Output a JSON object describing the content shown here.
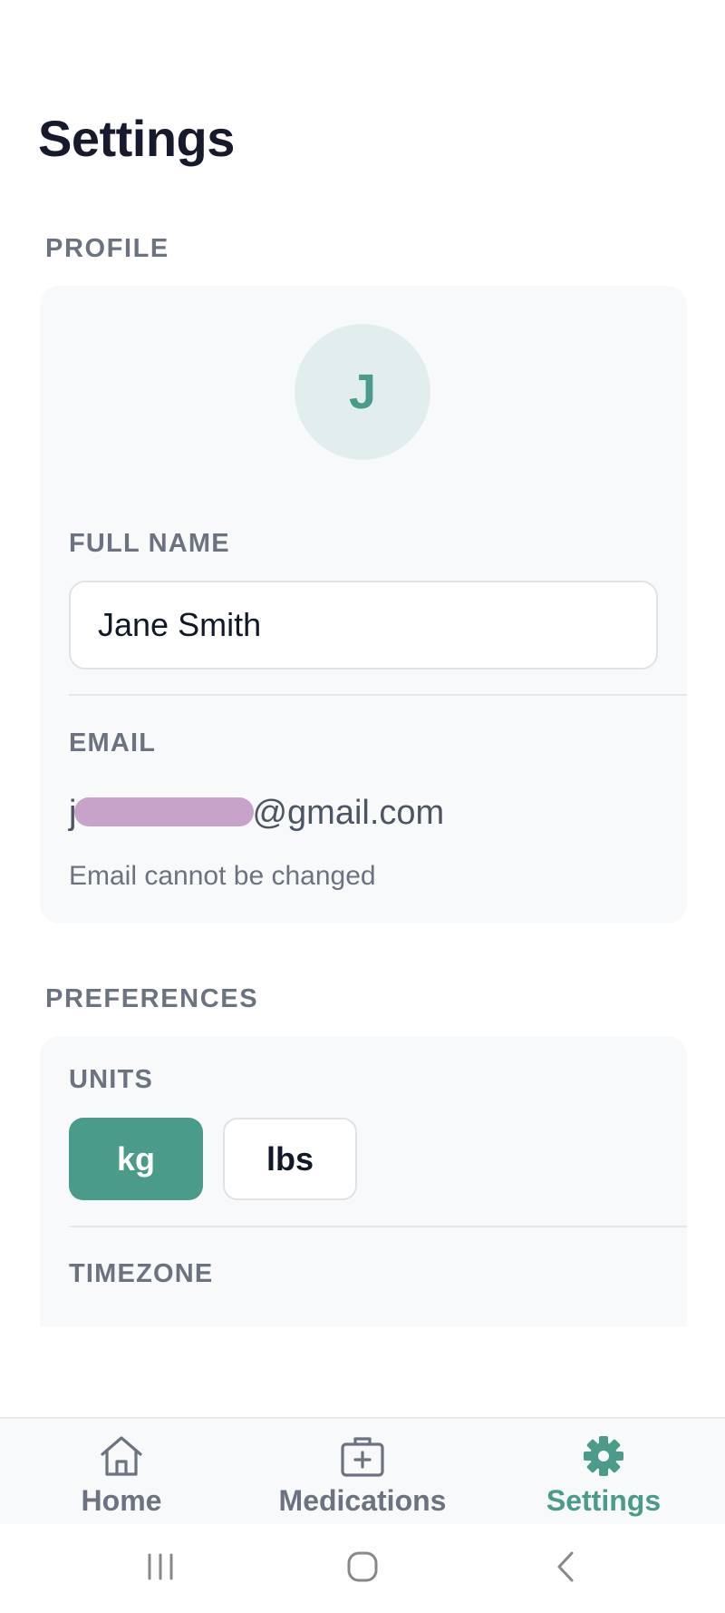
{
  "page": {
    "title": "Settings"
  },
  "profile": {
    "section_label": "PROFILE",
    "avatar_initial": "J",
    "full_name_label": "FULL NAME",
    "full_name_value": "Jane Smith",
    "email_label": "EMAIL",
    "email_prefix": "j",
    "email_suffix": "@gmail.com",
    "email_hint": "Email cannot be changed"
  },
  "preferences": {
    "section_label": "PREFERENCES",
    "units_label": "UNITS",
    "units_options": [
      "kg",
      "lbs"
    ],
    "units_selected": "kg",
    "timezone_label": "TIMEZONE"
  },
  "nav": {
    "items": [
      {
        "label": "Home",
        "icon": "home-icon",
        "active": false
      },
      {
        "label": "Medications",
        "icon": "medical-kit-icon",
        "active": false
      },
      {
        "label": "Settings",
        "icon": "gear-icon",
        "active": true
      }
    ]
  },
  "colors": {
    "accent": "#4a9b8a",
    "avatar_bg": "#e2eeed",
    "card_bg": "#f7f9fa",
    "muted_text": "#6b7280",
    "redaction": "#c8a3c9"
  }
}
